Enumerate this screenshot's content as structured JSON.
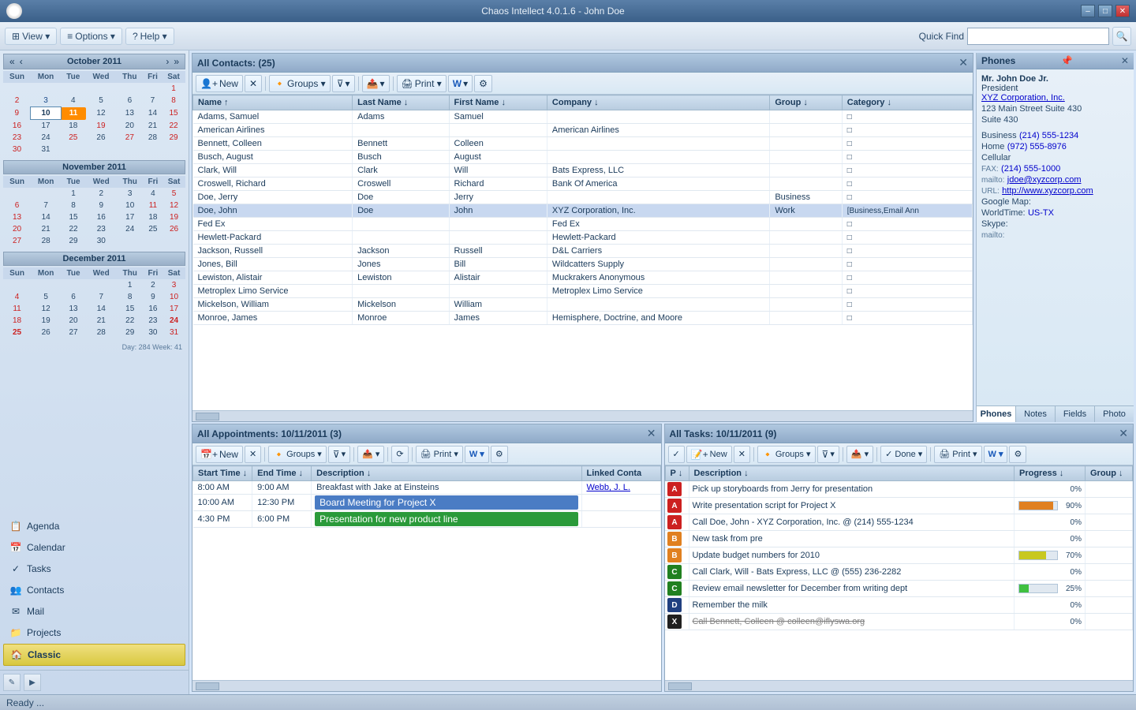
{
  "window": {
    "title": "Chaos Intellect 4.0.1.6 - John Doe",
    "minimize": "–",
    "maximize": "□",
    "close": "✕"
  },
  "menubar": {
    "view": "View ▾",
    "options": "Options ▾",
    "help": "Help ▾",
    "quickfind_label": "Quick Find",
    "quickfind_placeholder": ""
  },
  "sidebar": {
    "calendar_months": [
      {
        "name": "October 2011",
        "days_header": [
          "Sun",
          "Mon",
          "Tue",
          "Wed",
          "Thu",
          "Fri",
          "Sat"
        ],
        "weeks": [
          [
            "",
            "",
            "",
            "",
            "",
            "",
            "1"
          ],
          [
            "2",
            "3",
            "4",
            "5",
            "6",
            "7",
            "8"
          ],
          [
            "9",
            "10",
            "11",
            "12",
            "13",
            "14",
            "15"
          ],
          [
            "16",
            "17",
            "18",
            "19",
            "20",
            "21",
            "22"
          ],
          [
            "23",
            "24",
            "25",
            "26",
            "27",
            "28",
            "29"
          ],
          [
            "30",
            "31",
            "",
            "",
            "",
            "",
            ""
          ]
        ],
        "highlights": {
          "10": "today_box",
          "11": "orange"
        },
        "reds": [
          "2",
          "8",
          "9",
          "15",
          "16",
          "22",
          "23",
          "29",
          "30"
        ],
        "blues": [
          "3",
          "4",
          "5",
          "6",
          "7",
          "10",
          "11",
          "12",
          "13",
          "14",
          "17",
          "18",
          "19",
          "20",
          "21",
          "24",
          "25",
          "26",
          "27",
          "28",
          "31"
        ]
      },
      {
        "name": "November 2011",
        "days_header": [
          "Sun",
          "Mon",
          "Tue",
          "Wed",
          "Thu",
          "Fri",
          "Sat"
        ],
        "weeks": [
          [
            "",
            "",
            "1",
            "2",
            "3",
            "4",
            "5"
          ],
          [
            "6",
            "7",
            "8",
            "9",
            "10",
            "11",
            "12"
          ],
          [
            "13",
            "14",
            "15",
            "16",
            "17",
            "18",
            "19"
          ],
          [
            "20",
            "21",
            "22",
            "23",
            "24",
            "25",
            "26"
          ],
          [
            "27",
            "28",
            "29",
            "30",
            "",
            "",
            ""
          ]
        ],
        "reds": [
          "6",
          "12",
          "13",
          "19",
          "20",
          "26",
          "27"
        ],
        "blues": [],
        "highlights": {
          "11": "red_bold"
        }
      },
      {
        "name": "December 2011",
        "days_header": [
          "Sun",
          "Mon",
          "Tue",
          "Wed",
          "Thu",
          "Fri",
          "Sat"
        ],
        "weeks": [
          [
            "",
            "",
            "",
            "",
            "1",
            "2",
            "3"
          ],
          [
            "4",
            "5",
            "6",
            "7",
            "8",
            "9",
            "10"
          ],
          [
            "11",
            "12",
            "13",
            "14",
            "15",
            "16",
            "17"
          ],
          [
            "18",
            "19",
            "20",
            "21",
            "22",
            "23",
            "24"
          ],
          [
            "25",
            "26",
            "27",
            "28",
            "29",
            "30",
            "31"
          ]
        ],
        "reds": [
          "4",
          "10",
          "11",
          "17",
          "18",
          "24",
          "25",
          "31"
        ],
        "blues": [],
        "highlights": {
          "24": "red_bold",
          "25": "red_bold",
          "31": "red_bold"
        }
      }
    ],
    "day_week_info": "Day: 284  Week: 41",
    "nav_items": [
      {
        "id": "agenda",
        "label": "Agenda",
        "icon": "📋"
      },
      {
        "id": "calendar",
        "label": "Calendar",
        "icon": "📅"
      },
      {
        "id": "tasks",
        "label": "Tasks",
        "icon": "✓"
      },
      {
        "id": "contacts",
        "label": "Contacts",
        "icon": "👥"
      },
      {
        "id": "mail",
        "label": "Mail",
        "icon": "✉"
      },
      {
        "id": "projects",
        "label": "Projects",
        "icon": "📁"
      },
      {
        "id": "classic",
        "label": "Classic",
        "icon": "🏠"
      }
    ]
  },
  "contacts_panel": {
    "title": "All Contacts:",
    "count": "(25)",
    "toolbar": {
      "new_btn": "New",
      "delete_btn": "✕",
      "groups_btn": "Groups ▾",
      "filter_btn": "▾",
      "export_btn": "▾",
      "print_btn": "Print ▾",
      "word_btn": "W ▾",
      "extra_btn": "⚙"
    },
    "columns": [
      "Name ↑",
      "Last Name ↓",
      "First Name ↓",
      "Company ↓",
      "Group ↓",
      "Category ↓"
    ],
    "rows": [
      {
        "name": "Adams, Samuel",
        "last": "Adams",
        "first": "Samuel",
        "company": "",
        "group": "",
        "category": "□"
      },
      {
        "name": "American Airlines",
        "last": "",
        "first": "",
        "company": "American Airlines",
        "group": "",
        "category": "□"
      },
      {
        "name": "Bennett, Colleen",
        "last": "Bennett",
        "first": "Colleen",
        "company": "",
        "group": "",
        "category": "□"
      },
      {
        "name": "Busch, August",
        "last": "Busch",
        "first": "August",
        "company": "",
        "group": "",
        "category": "□"
      },
      {
        "name": "Clark, Will",
        "last": "Clark",
        "first": "Will",
        "company": "Bats Express, LLC",
        "group": "",
        "category": "□"
      },
      {
        "name": "Croswell, Richard",
        "last": "Croswell",
        "first": "Richard",
        "company": "Bank Of America",
        "group": "",
        "category": "□"
      },
      {
        "name": "Doe, Jerry",
        "last": "Doe",
        "first": "Jerry",
        "company": "",
        "group": "Business",
        "category": "□"
      },
      {
        "name": "Doe, John",
        "last": "Doe",
        "first": "John",
        "company": "XYZ Corporation, Inc.",
        "group": "Work",
        "category": "[Business,Email Ann",
        "selected": true
      },
      {
        "name": "Fed Ex",
        "last": "",
        "first": "",
        "company": "Fed Ex",
        "group": "",
        "category": "□"
      },
      {
        "name": "Hewlett-Packard",
        "last": "",
        "first": "",
        "company": "Hewlett-Packard",
        "group": "",
        "category": "□"
      },
      {
        "name": "Jackson, Russell",
        "last": "Jackson",
        "first": "Russell",
        "company": "D&L Carriers",
        "group": "",
        "category": "□"
      },
      {
        "name": "Jones, Bill",
        "last": "Jones",
        "first": "Bill",
        "company": "Wildcatters Supply",
        "group": "",
        "category": "□"
      },
      {
        "name": "Lewiston, Alistair",
        "last": "Lewiston",
        "first": "Alistair",
        "company": "Muckrakers Anonymous",
        "group": "",
        "category": "□"
      },
      {
        "name": "Metroplex Limo Service",
        "last": "",
        "first": "",
        "company": "Metroplex Limo Service",
        "group": "",
        "category": "□"
      },
      {
        "name": "Mickelson, William",
        "last": "Mickelson",
        "first": "William",
        "company": "",
        "group": "",
        "category": "□"
      },
      {
        "name": "Monroe, James",
        "last": "Monroe",
        "first": "James",
        "company": "Hemisphere, Doctrine, and Moore",
        "group": "",
        "category": "□"
      }
    ]
  },
  "appointments_panel": {
    "title": "All Appointments: 10/11/2011",
    "count": "(3)",
    "toolbar": {
      "new_btn": "New",
      "delete_btn": "✕",
      "groups_btn": "Groups ▾",
      "filter_btn": "▾",
      "export_btn": "▾",
      "sync_btn": "⟳",
      "print_btn": "Print ▾",
      "word_btn": "W ▾",
      "extra_btn": "⚙"
    },
    "columns": [
      "Start Time ↓",
      "End Time ↓",
      "Description ↓",
      "Linked Conta"
    ],
    "rows": [
      {
        "start": "8:00 AM",
        "end": "9:00 AM",
        "desc": "Breakfast with Jake at Einsteins",
        "contact": "Webb, J. L.",
        "style": "normal"
      },
      {
        "start": "10:00 AM",
        "end": "12:30 PM",
        "desc": "Board Meeting for Project X",
        "contact": "",
        "style": "blue"
      },
      {
        "start": "4:30 PM",
        "end": "6:00 PM",
        "desc": "Presentation for new product line",
        "contact": "",
        "style": "green"
      }
    ]
  },
  "tasks_panel": {
    "title": "All Tasks: 10/11/2011",
    "count": "(9)",
    "toolbar": {
      "check_btn": "✓",
      "new_btn": "New",
      "delete_btn": "✕",
      "groups_btn": "Groups ▾",
      "filter_btn": "▾",
      "export_btn": "▾",
      "done_btn": "Done ▾",
      "print_btn": "Print ▾",
      "word_btn": "W ▾",
      "extra_btn": "⚙"
    },
    "columns": [
      "P ↓",
      "Description ↓",
      "Progress ↓",
      "Group ↓"
    ],
    "rows": [
      {
        "priority": "A",
        "desc": "Pick up storyboards from Jerry for presentation",
        "progress": 0,
        "group": "",
        "style": "normal"
      },
      {
        "priority": "A",
        "desc": "Write presentation script for Project X",
        "progress": 90,
        "group": "",
        "style": "normal",
        "bar_color": "#e08020"
      },
      {
        "priority": "A",
        "desc": "Call Doe, John - XYZ Corporation, Inc. @ (214) 555-1234",
        "progress": 0,
        "group": "",
        "style": "normal"
      },
      {
        "priority": "B",
        "desc": "New task from pre",
        "progress": 0,
        "group": "",
        "style": "normal"
      },
      {
        "priority": "B",
        "desc": "Update budget numbers for 2010",
        "progress": 70,
        "group": "",
        "style": "normal",
        "bar_color": "#c8c820"
      },
      {
        "priority": "C",
        "desc": "Call Clark, Will - Bats Express, LLC @ (555) 236-2282",
        "progress": 0,
        "group": "",
        "style": "normal"
      },
      {
        "priority": "C",
        "desc": "Review email newsletter for December from writing dept",
        "progress": 25,
        "group": "",
        "style": "normal",
        "bar_color": "#40c040"
      },
      {
        "priority": "D",
        "desc": "Remember the milk",
        "progress": 0,
        "group": "",
        "style": "normal"
      },
      {
        "priority": "X",
        "desc": "Call Bennett, Colleen @ colleen@iflyswa.org",
        "progress": 0,
        "group": "",
        "style": "strikethrough"
      }
    ]
  },
  "phones_panel": {
    "title": "Phones",
    "contact": {
      "name": "Mr. John Doe Jr.",
      "title": "President",
      "company": "XYZ Corporation, Inc.",
      "address1": "123 Main Street Suite 430",
      "address2": "Suite 430",
      "business_label": "Business",
      "business_phone": "(214) 555-1234",
      "home_label": "Home",
      "home_phone": "(972) 555-8976",
      "cellular_label": "Cellular",
      "fax_label": "FAX:",
      "fax_phone": "(214) 555-1000",
      "email_label": "mailto:",
      "email": "jdoe@xyzcorp.com",
      "url_label": "URL:",
      "url": "http://www.xyzcorp.com",
      "googlemap_label": "Google Map:",
      "worldtime_label": "WorldTime:",
      "worldtime_val": "US-TX",
      "skype_label": "Skype:",
      "skype_mailto_label": "mailto:"
    },
    "tabs": [
      "Phones",
      "Notes",
      "Fields",
      "Photo"
    ]
  },
  "status_bar": {
    "text": "Ready ..."
  }
}
